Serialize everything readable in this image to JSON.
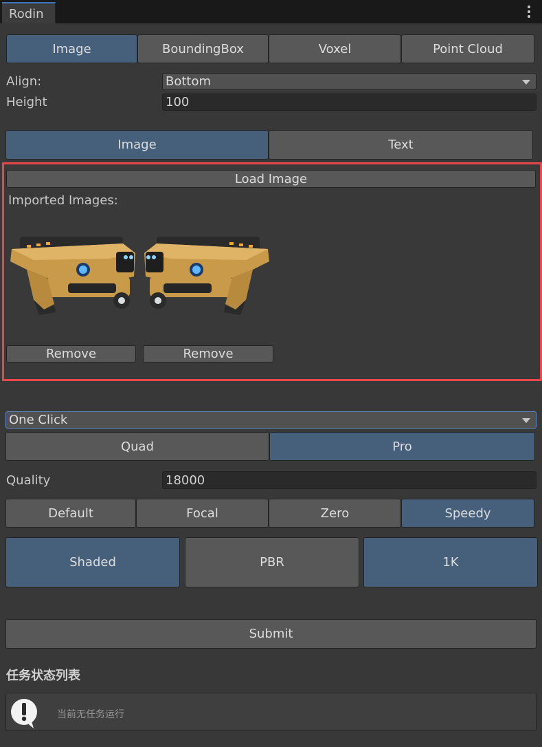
{
  "window": {
    "tab_title": "Rodin"
  },
  "mode_tabs": [
    "Image",
    "BoundingBox",
    "Voxel",
    "Point Cloud"
  ],
  "mode_selected": "Image",
  "align": {
    "label": "Align:",
    "value": "Bottom"
  },
  "height": {
    "label": "Height",
    "value": "100"
  },
  "input_tabs": [
    "Image",
    "Text"
  ],
  "input_selected": "Image",
  "image_panel": {
    "load_label": "Load Image",
    "imported_label": "Imported Images:",
    "images": [
      {
        "icon": "sci-fi-gun-image",
        "remove_label": "Remove"
      },
      {
        "icon": "sci-fi-gun-image-mirrored",
        "remove_label": "Remove"
      }
    ]
  },
  "generation": {
    "value": "One Click"
  },
  "mesh_tabs": [
    "Quad",
    "Pro"
  ],
  "mesh_selected": "Pro",
  "quality": {
    "label": "Quality",
    "value": "18000"
  },
  "style_tabs": [
    "Default",
    "Focal",
    "Zero",
    "Speedy"
  ],
  "style_selected": "Speedy",
  "material_buttons": [
    {
      "label": "Shaded",
      "selected": true
    },
    {
      "label": "PBR",
      "selected": false
    },
    {
      "label": "1K",
      "selected": true
    }
  ],
  "submit_label": "Submit",
  "task_list": {
    "title": "任务状态列表",
    "status_icon": "alert-speech-bubble-icon",
    "empty_text": "当前无任务运行"
  },
  "colors": {
    "accent": "#46607c",
    "highlight_border": "#e8464b",
    "background": "#383838"
  }
}
